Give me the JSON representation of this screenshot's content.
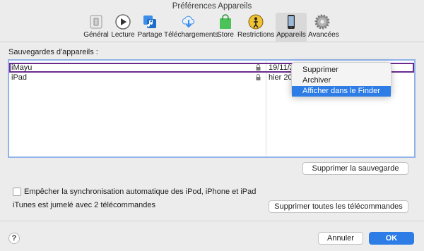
{
  "window": {
    "title": "Préférences Appareils"
  },
  "toolbar": {
    "items": [
      {
        "label": "Général",
        "icon": "general-switch-icon"
      },
      {
        "label": "Lecture",
        "icon": "play-icon"
      },
      {
        "label": "Partage",
        "icon": "sharing-icon"
      },
      {
        "label": "Téléchargements",
        "icon": "download-cloud-icon"
      },
      {
        "label": "Store",
        "icon": "store-bag-icon"
      },
      {
        "label": "Restrictions",
        "icon": "restrictions-icon"
      },
      {
        "label": "Appareils",
        "icon": "device-icon",
        "active": true
      },
      {
        "label": "Avancées",
        "icon": "gear-icon"
      }
    ]
  },
  "backups": {
    "label": "Sauvegardes d'appareils :",
    "rows": [
      {
        "name": "iMayu",
        "date": "19/11/2"
      },
      {
        "name": "iPad",
        "date": "hier 20"
      }
    ],
    "delete_button": "Supprimer la sauvegarde"
  },
  "context_menu": {
    "items": [
      "Supprimer",
      "Archiver",
      "Afficher dans le Finder"
    ],
    "highlighted_index": 2
  },
  "sync": {
    "checkbox_label": "Empêcher la synchronisation automatique des iPod, iPhone et iPad",
    "checked": false
  },
  "remotes": {
    "info": "iTunes est jumelé avec 2 télécommandes",
    "button": "Supprimer toutes les télécommandes"
  },
  "footer": {
    "help": "?",
    "cancel": "Annuler",
    "ok": "OK"
  },
  "colors": {
    "accent": "#2e7de6",
    "selection_outline": "#6a2b8f",
    "list_focus_border": "#8fb2e8"
  }
}
